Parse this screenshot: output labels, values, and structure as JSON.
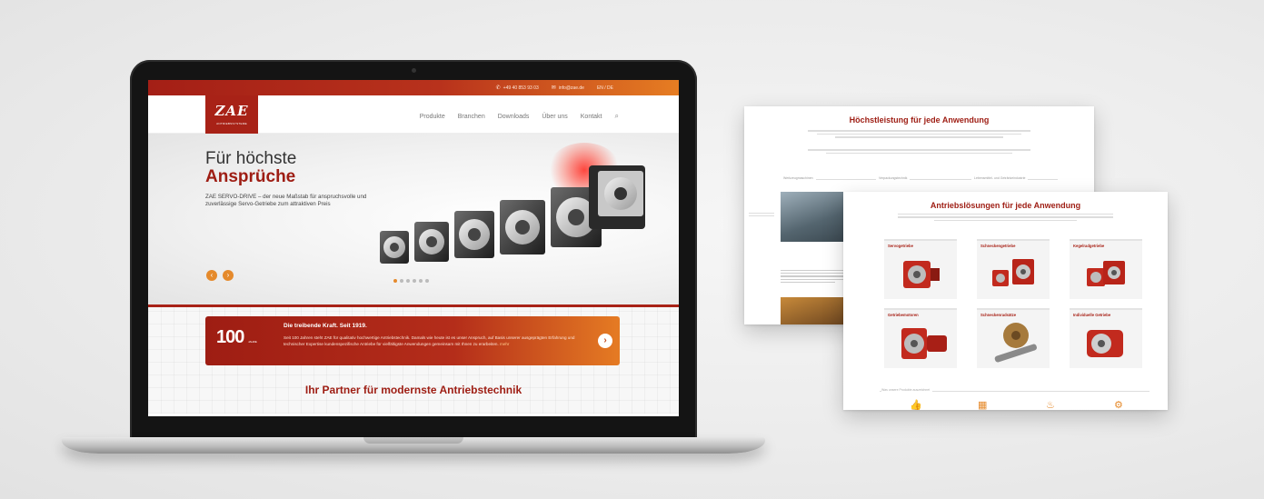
{
  "laptop": {
    "topbar": {
      "phone": "+49 40 853 93 03",
      "email": "info@zae.de",
      "lang": "EN / DE"
    },
    "logo": {
      "mark": "ZAE",
      "sub": "ANTRIEBSSYSTEME"
    },
    "nav": [
      "Produkte",
      "Branchen",
      "Downloads",
      "Über uns",
      "Kontakt"
    ],
    "hero": {
      "title_line1": "Für höchste",
      "title_line2": "Ansprüche",
      "text": "ZAE SERVO-DRIVE – der neue Maßstab für anspruchsvolle und zuverlässige Servo-Getriebe zum attraktiven Preis",
      "slide_count": 6,
      "active_slide": 0
    },
    "banner": {
      "badge": "100",
      "badge_sub": "JAHRE",
      "title": "Die treibende Kraft. Seit 1919.",
      "text": "Seit 100 Jahren steht ZAE für qualitativ hochwertige Antriebstechnik. Damals wie heute ist es unser Anspruch, auf Basis unserer ausgeprägten Erfahrung und technischer Expertise kundenspezifische Antriebe für vielfältigste Anwendungen gemeinsam mit Ihnen zu erarbeiten.",
      "more": "mehr"
    },
    "bottom_title": "Ihr Partner für modernste Antriebstechnik"
  },
  "card1": {
    "title": "Höchstleistung für jede Anwendung",
    "labels": [
      "Werkzeugmaschinen",
      "Verpackungstechnik",
      "Lebensmittel- und Getränkeindustrie"
    ],
    "more": "mehr"
  },
  "card2": {
    "title": "Antriebslösungen für jede Anwendung",
    "tiles": [
      "Servogetriebe",
      "Schneckengetriebe",
      "Kegelradgetriebe",
      "Getriebemotoren",
      "Schneckenradsätze",
      "Individuelle Getriebe"
    ],
    "footer_label": "Was unsere Produkte auszeichnet"
  },
  "colors": {
    "brand_red": "#a82217",
    "accent_orange": "#e58a2c"
  }
}
